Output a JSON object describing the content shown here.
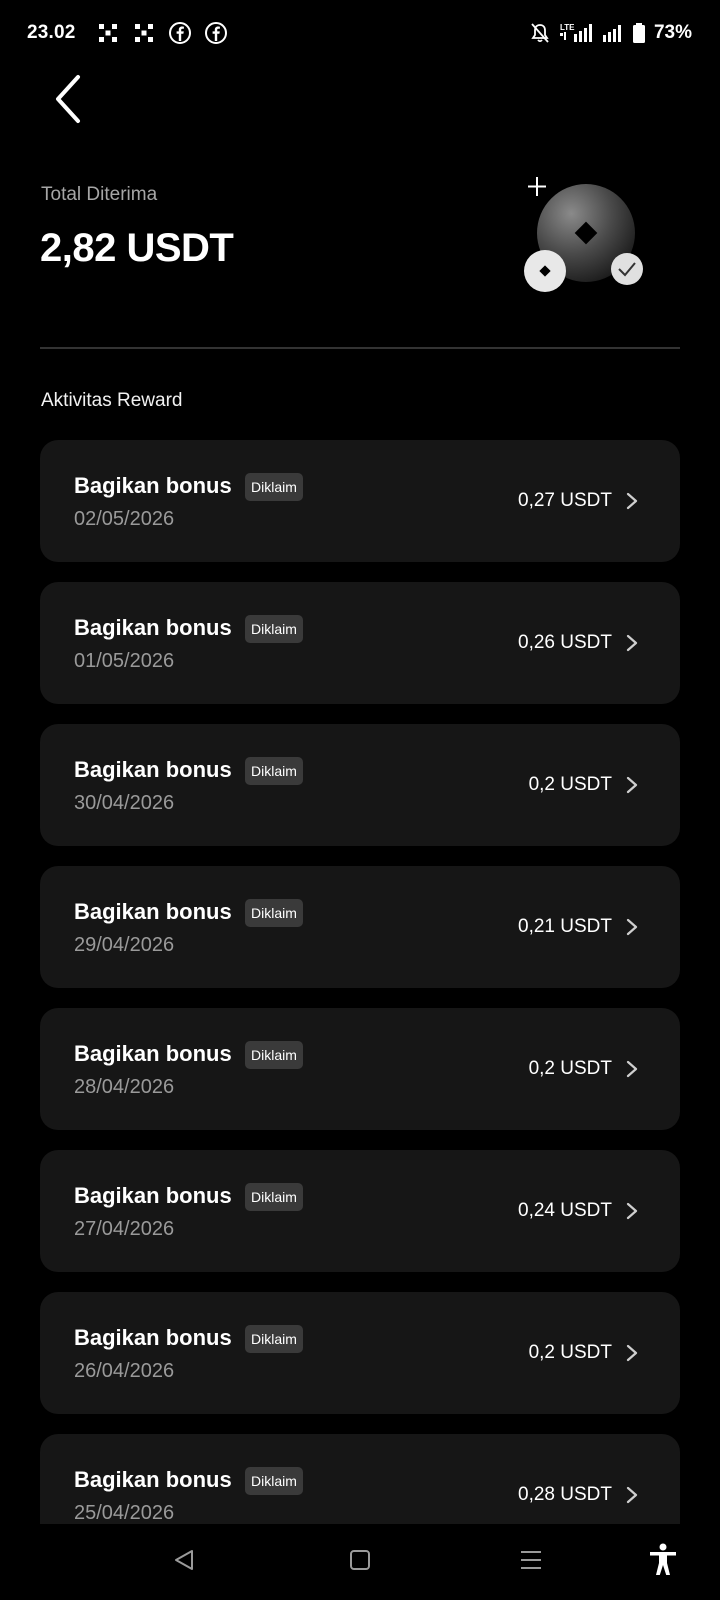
{
  "status_bar": {
    "time": "23.02",
    "left_icons": [
      "app-grid-icon",
      "app-grid-icon",
      "facebook-icon",
      "facebook-icon"
    ],
    "right_icons": [
      "mute-bell-icon",
      "lte-signal-icon",
      "signal-icon",
      "battery-icon"
    ],
    "battery_percent": "73%"
  },
  "header": {
    "back_icon": "chevron-left-icon"
  },
  "summary": {
    "label": "Total Diterima",
    "value": "2,82 USDT"
  },
  "section_title": "Aktivitas Reward",
  "rewards": [
    {
      "title": "Bagikan bonus",
      "badge": "Diklaim",
      "date": "02/05/2026",
      "amount": "0,27 USDT"
    },
    {
      "title": "Bagikan bonus",
      "badge": "Diklaim",
      "date": "01/05/2026",
      "amount": "0,26 USDT"
    },
    {
      "title": "Bagikan bonus",
      "badge": "Diklaim",
      "date": "30/04/2026",
      "amount": "0,2 USDT"
    },
    {
      "title": "Bagikan bonus",
      "badge": "Diklaim",
      "date": "29/04/2026",
      "amount": "0,21 USDT"
    },
    {
      "title": "Bagikan bonus",
      "badge": "Diklaim",
      "date": "28/04/2026",
      "amount": "0,2 USDT"
    },
    {
      "title": "Bagikan bonus",
      "badge": "Diklaim",
      "date": "27/04/2026",
      "amount": "0,24 USDT"
    },
    {
      "title": "Bagikan bonus",
      "badge": "Diklaim",
      "date": "26/04/2026",
      "amount": "0,2 USDT"
    },
    {
      "title": "Bagikan bonus",
      "badge": "Diklaim",
      "date": "25/04/2026",
      "amount": "0,28 USDT"
    }
  ],
  "nav_bar": {
    "icons": [
      "back-triangle-icon",
      "home-square-icon",
      "recents-menu-icon",
      "accessibility-icon"
    ]
  },
  "colors": {
    "background": "#000000",
    "card": "#161616",
    "badge": "#3a3a3a",
    "muted_text": "#9a9a9a",
    "divider": "#333333"
  }
}
